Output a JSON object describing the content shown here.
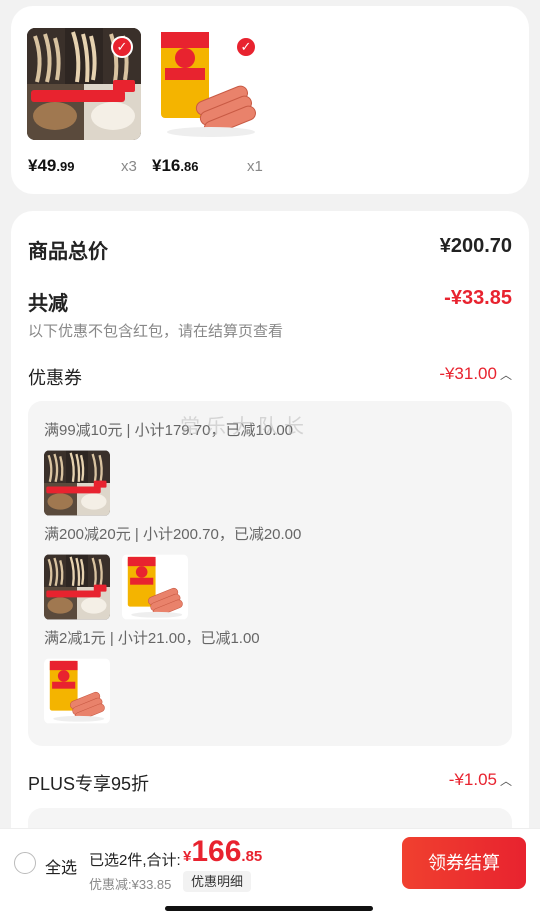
{
  "cart_items": [
    {
      "price_symbol": "¥",
      "price_int": "49",
      "price_dec": ".99",
      "qty": "x3",
      "image": {
        "badge": "4.18日 秒杀59.9元",
        "tag": "3斤"
      }
    },
    {
      "price_symbol": "¥",
      "price_int": "16",
      "price_dec": ".86",
      "qty": "x1",
      "image": {
        "badge": "金锣王中王"
      }
    }
  ],
  "summary": {
    "total_label": "商品总价",
    "total_value": "¥200.70",
    "discount_label": "共减",
    "discount_value": "-¥33.85",
    "discount_note": "以下优惠不包含红包，请在结算页查看",
    "coupon_label": "优惠券",
    "coupon_value": "-¥31.00",
    "plus_label": "PLUS专享95折",
    "plus_value": "-¥1.05"
  },
  "coupons": [
    {
      "title": "满99减10元 | 小计179.70，已减10.00"
    },
    {
      "title": "满200减20元 | 小计200.70，已减20.00"
    },
    {
      "title": "满2减1元 | 小计21.00，已减1.00"
    }
  ],
  "watermark": "常乐大队长",
  "bottom_bar": {
    "select_all": "全选",
    "selected_label": "已选2件,合计:",
    "total_symbol": "¥",
    "total_int": "166",
    "total_dec": ".85",
    "discount_text": "优惠减:¥33.85",
    "detail_button": "优惠明细",
    "pay_button": "领券结算"
  },
  "colors": {
    "accent": "#e8232f",
    "background": "#f2f2f2"
  }
}
